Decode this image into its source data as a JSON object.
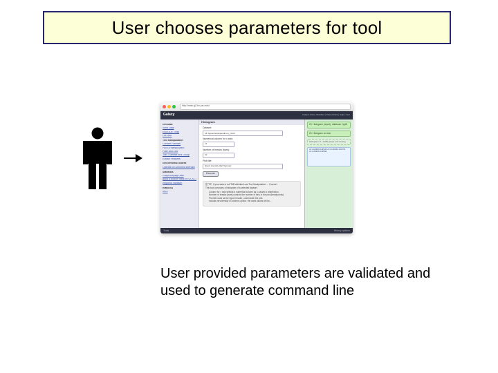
{
  "title": "User chooses parameters for tool",
  "caption_line1": "User provided parameters are validated and",
  "caption_line2": "used to generate command line",
  "app": {
    "url": "http://main.g2.bx.psu.edu/",
    "brand": "Galaxy",
    "header_right": "Analyze Data | Workflow | Shared Data | Help | User",
    "footer_left": "Tools",
    "footer_right": "History options",
    "center_title": "Histogram",
    "leftnav": [
      "Get Data",
      "Send Data",
      "ENCODE Tools",
      "Lift-Over",
      "Text Manipulation",
      "Convert Formats",
      "FASTA manipulation",
      "Filter and Sort",
      "Join, Subtract and Group",
      "Extract Features",
      "Get Genomic Scores",
      "Operate on Genomic Intervals",
      "Statistics",
      "Graph/Display Data",
      "Build a custom track for UCSC genome browser",
      "Regional Variation",
      "EMBOSS",
      "NGS"
    ],
    "form": {
      "dataset_label": "Dataset:",
      "dataset_value": "18: hgcentral.Appendix.no_NA.R",
      "col_label": "Numerical column for x axis:",
      "col_value": "c7",
      "breaks_label": "Number of breaks (bars):",
      "breaks_value": "10",
      "title_label": "Plot title:",
      "title_value": "Query intensity (bar %group)",
      "exec": "Execute"
    },
    "tip": {
      "headline": "TIP: If your data is not TAB delimited use Text Manipulation → Convert",
      "desc": "This tool computes a histogram of a selected dataset.",
      "b1": "Column for x axis selects a numerical column as x-values in distribution.",
      "b2": "Number of breaks (bars) controls the number of bins in the plot (breakpoints).",
      "b3": "Plot title used as the figure header, underneath the plot.",
      "b4": "Include zero/density in columns option: the used values will be..."
    },
    "right": {
      "run1": "20: Histogram (report), database: hg18",
      "run2": "20: Histogram on #var",
      "in1": "Histogram of ~1,000 genes: job running",
      "preview": "chr1   1294834   1295103\nchr1   1300482   1300703\nchr1   1305631   1305822"
    }
  }
}
